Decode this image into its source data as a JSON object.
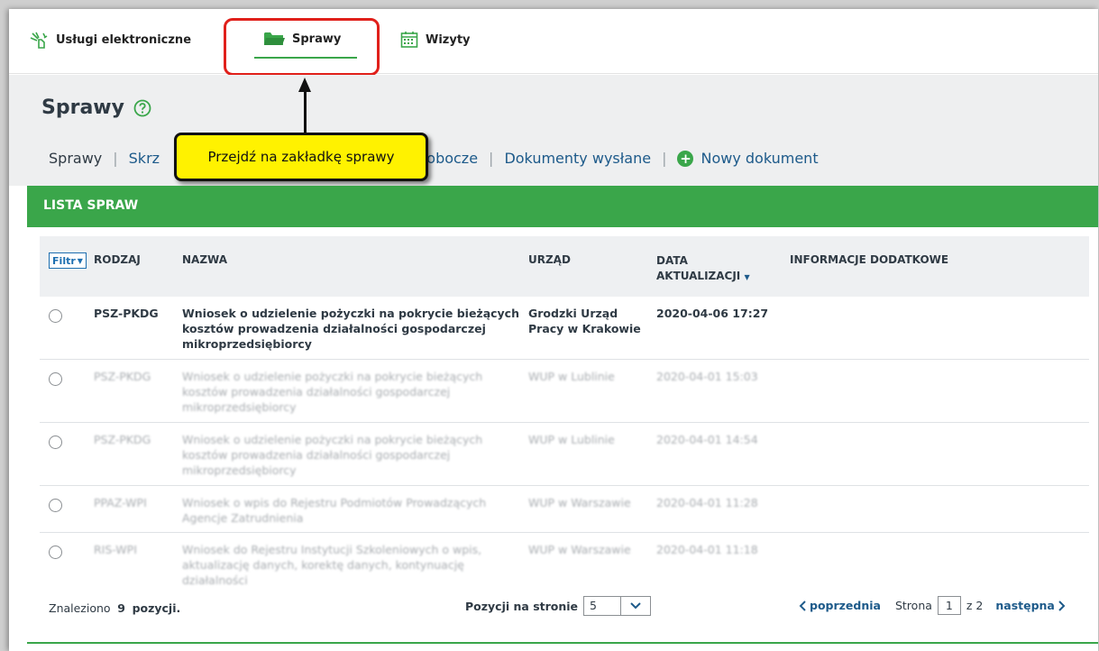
{
  "topnav": {
    "uslugi_label": "Usługi elektroniczne",
    "sprawy_label": "Sprawy",
    "wizyty_label": "Wizyty"
  },
  "page": {
    "title": "Sprawy",
    "help_icon": "question-circle-icon"
  },
  "subnav": {
    "items": [
      "Sprawy",
      "Skrz",
      "robocze",
      "Dokumenty wysłane",
      "Nowy dokument"
    ]
  },
  "callout": {
    "text": "Przejdź na zakładkę sprawy"
  },
  "list": {
    "header": "LISTA SPRAW",
    "filter_label": "Filtr",
    "columns": [
      "RODZAJ",
      "NAZWA",
      "URZĄD",
      "DATA AKTUALIZACJI",
      "INFORMACJE DODATKOWE"
    ],
    "rows": [
      {
        "rodzaj": "PSZ-PKDG",
        "nazwa": "Wniosek o udzielenie pożyczki na pokrycie bieżących kosztów prowadzenia działalności gospodarczej mikroprzedsiębiorcy",
        "urzad": "Grodzki Urząd Pracy w Krakowie",
        "data": "2020-04-06 17:27"
      },
      {
        "rodzaj": "PSZ-PKDG",
        "nazwa": "Wniosek o udzielenie pożyczki na pokrycie bieżących kosztów prowadzenia działalności gospodarczej mikroprzedsiębiorcy",
        "urzad": "WUP w Lublinie",
        "data": "2020-04-01 15:03"
      },
      {
        "rodzaj": "PSZ-PKDG",
        "nazwa": "Wniosek o udzielenie pożyczki na pokrycie bieżących kosztów prowadzenia działalności gospodarczej mikroprzedsiębiorcy",
        "urzad": "WUP w Lublinie",
        "data": "2020-04-01 14:54"
      },
      {
        "rodzaj": "PPAZ-WPI",
        "nazwa": "Wniosek o wpis do Rejestru Podmiotów Prowadzących Agencje Zatrudnienia",
        "urzad": "WUP w Warszawie",
        "data": "2020-04-01 11:28"
      },
      {
        "rodzaj": "RIS-WPI",
        "nazwa": "Wniosek do Rejestru Instytucji Szkoleniowych o wpis, aktualizację danych, korektę danych, kontynuację działalności",
        "urzad": "WUP w Warszawie",
        "data": "2020-04-01 11:18"
      }
    ]
  },
  "footer": {
    "found_prefix": "Znaleziono",
    "found_count": "9",
    "found_suffix": "pozycji.",
    "per_page_label": "Pozycji na stronie",
    "per_page_value": "5",
    "prev_label": "poprzednia",
    "page_label": "Strona",
    "page_value": "1",
    "page_total": "z 2",
    "next_label": "następna"
  },
  "colors": {
    "accent_green": "#3aa64a",
    "highlight_red": "#e0201b",
    "callout_yellow": "#fff200",
    "link_blue": "#1d5a8a"
  }
}
